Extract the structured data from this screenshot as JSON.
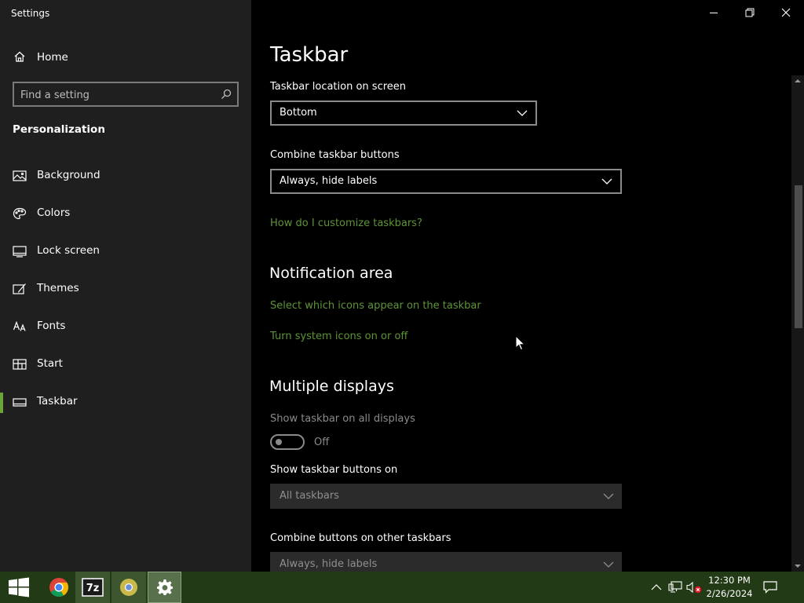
{
  "window": {
    "title": "Settings"
  },
  "sidebar": {
    "home_label": "Home",
    "search_placeholder": "Find a setting",
    "section": "Personalization",
    "items": [
      {
        "label": "Background",
        "icon": "picture-icon"
      },
      {
        "label": "Colors",
        "icon": "palette-icon"
      },
      {
        "label": "Lock screen",
        "icon": "lock-screen-icon"
      },
      {
        "label": "Themes",
        "icon": "brush-icon"
      },
      {
        "label": "Fonts",
        "icon": "fonts-icon"
      },
      {
        "label": "Start",
        "icon": "start-tiles-icon"
      },
      {
        "label": "Taskbar",
        "icon": "taskbar-icon",
        "selected": true
      }
    ]
  },
  "main": {
    "title": "Taskbar",
    "location": {
      "label": "Taskbar location on screen",
      "value": "Bottom"
    },
    "combine": {
      "label": "Combine taskbar buttons",
      "value": "Always, hide labels"
    },
    "customize_link": "How do I customize taskbars?",
    "notification": {
      "heading": "Notification area",
      "link1": "Select which icons appear on the taskbar",
      "link2": "Turn system icons on or off"
    },
    "multiple": {
      "heading": "Multiple displays",
      "show_all_label": "Show taskbar on all displays",
      "toggle_state": "Off",
      "buttons_on_label": "Show taskbar buttons on",
      "buttons_on_value": "All taskbars",
      "combine_other_label": "Combine buttons on other taskbars",
      "combine_other_value": "Always, hide labels"
    }
  },
  "taskbar": {
    "apps": [
      "start-windows-icon",
      "chrome-icon",
      "7zip-icon",
      "chrome-alt-icon",
      "settings-gear-icon"
    ],
    "time": "12:30 PM",
    "date": "2/26/2024"
  },
  "colors": {
    "accent": "#6ba539",
    "link": "#5d9436",
    "taskbar": "#233a17",
    "sidebar": "#1f1f1f"
  }
}
